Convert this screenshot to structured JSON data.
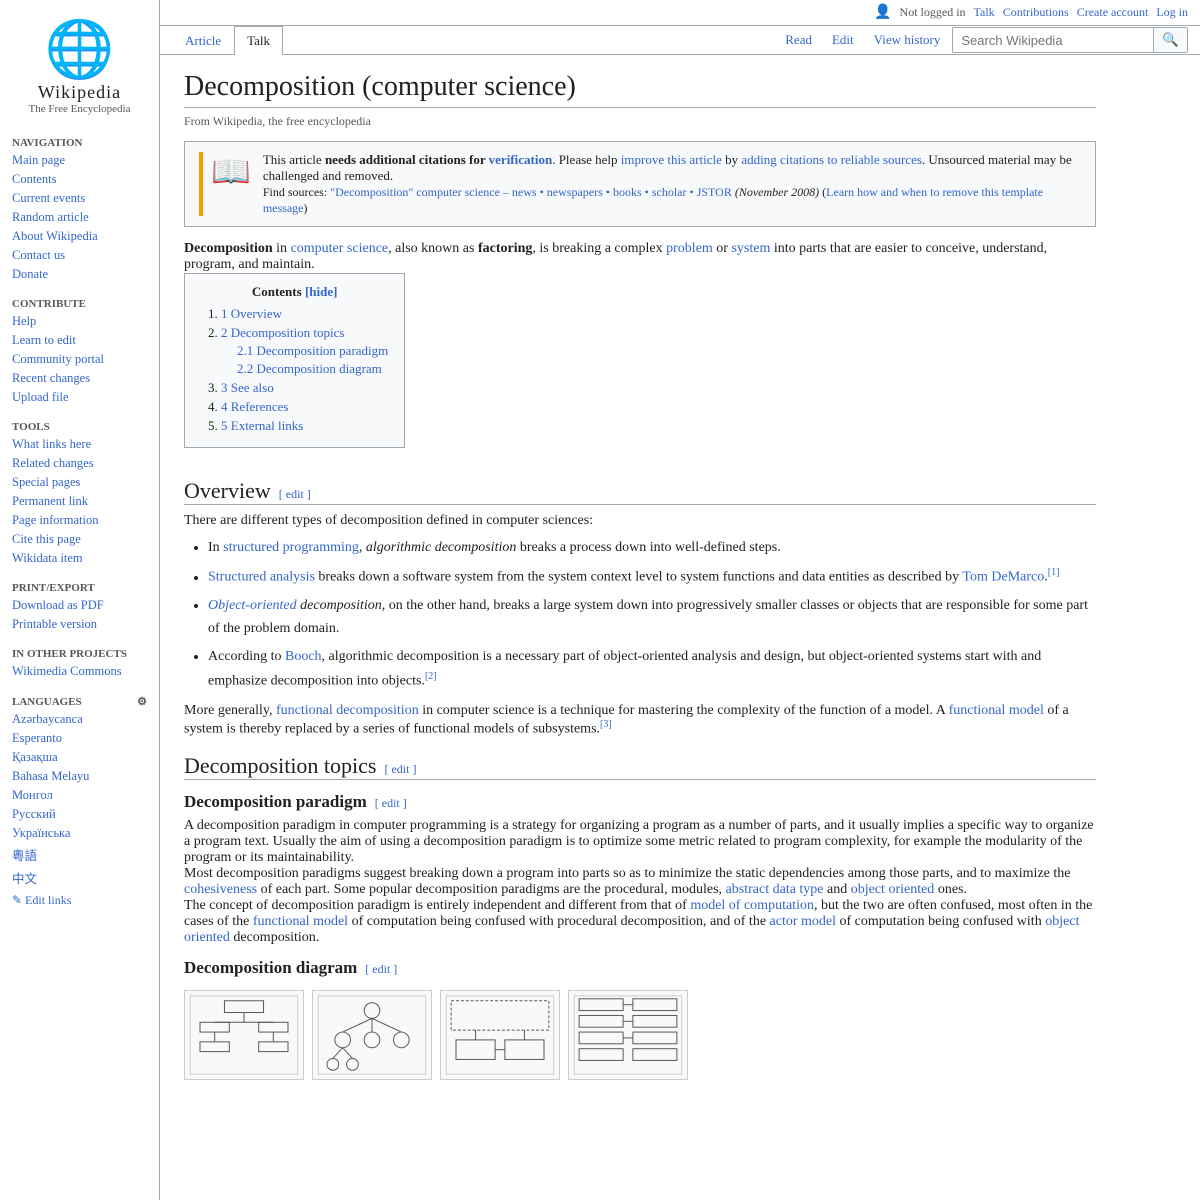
{
  "topbar": {
    "not_logged_in": "Not logged in",
    "talk": "Talk",
    "contributions": "Contributions",
    "create_account": "Create account",
    "log_in": "Log in"
  },
  "tabs": {
    "article": "Article",
    "talk": "Talk",
    "read": "Read",
    "edit": "Edit",
    "view_history": "View history"
  },
  "search": {
    "placeholder": "Search Wikipedia"
  },
  "logo": {
    "site_name": "Wikipedia",
    "tagline": "The Free Encyclopedia"
  },
  "sidebar": {
    "navigation_title": "Navigation",
    "nav_items": [
      {
        "label": "Main page",
        "href": "#"
      },
      {
        "label": "Contents",
        "href": "#"
      },
      {
        "label": "Current events",
        "href": "#"
      },
      {
        "label": "Random article",
        "href": "#"
      },
      {
        "label": "About Wikipedia",
        "href": "#"
      },
      {
        "label": "Contact us",
        "href": "#"
      },
      {
        "label": "Donate",
        "href": "#"
      }
    ],
    "contribute_title": "Contribute",
    "contribute_items": [
      {
        "label": "Help",
        "href": "#"
      },
      {
        "label": "Learn to edit",
        "href": "#"
      },
      {
        "label": "Community portal",
        "href": "#"
      },
      {
        "label": "Recent changes",
        "href": "#"
      },
      {
        "label": "Upload file",
        "href": "#"
      }
    ],
    "tools_title": "Tools",
    "tools_items": [
      {
        "label": "What links here",
        "href": "#"
      },
      {
        "label": "Related changes",
        "href": "#"
      },
      {
        "label": "Special pages",
        "href": "#"
      },
      {
        "label": "Permanent link",
        "href": "#"
      },
      {
        "label": "Page information",
        "href": "#"
      },
      {
        "label": "Cite this page",
        "href": "#"
      },
      {
        "label": "Wikidata item",
        "href": "#"
      }
    ],
    "printexport_title": "Print/export",
    "printexport_items": [
      {
        "label": "Download as PDF",
        "href": "#"
      },
      {
        "label": "Printable version",
        "href": "#"
      }
    ],
    "otherprojects_title": "In other projects",
    "otherprojects_items": [
      {
        "label": "Wikimedia Commons",
        "href": "#"
      }
    ],
    "languages_title": "Languages",
    "language_items": [
      {
        "label": "Azərbaycanca",
        "href": "#"
      },
      {
        "label": "Esperanto",
        "href": "#"
      },
      {
        "label": "Қазақша",
        "href": "#"
      },
      {
        "label": "Bahasa Melayu",
        "href": "#"
      },
      {
        "label": "Монгол",
        "href": "#"
      },
      {
        "label": "Русский",
        "href": "#"
      },
      {
        "label": "Українська",
        "href": "#"
      },
      {
        "label": "粵語",
        "href": "#"
      },
      {
        "label": "中文",
        "href": "#"
      }
    ],
    "edit_links": "✎ Edit links"
  },
  "article": {
    "title": "Decomposition (computer science)",
    "from_wiki": "From Wikipedia, the free encyclopedia",
    "citation_box": {
      "text1": "This article ",
      "bold1": "needs additional citations for ",
      "link1": "verification",
      "text2": ". Please help ",
      "link2": "improve this article",
      "text3": " by ",
      "link3": "adding citations to reliable sources",
      "text4": ". Unsourced material may be challenged and removed.",
      "find": "Find sources: ",
      "find_links": "\"Decomposition\" computer science – news • newspapers • books • scholar • JSTOR",
      "date": "(November 2008)",
      "learn": "(Learn how and when to remove this template message)"
    },
    "intro": "Decomposition in computer science, also known as factoring, is breaking a complex problem or system into parts that are easier to conceive, understand, program, and maintain.",
    "toc": {
      "title": "Contents",
      "hide": "[hide]",
      "items": [
        {
          "num": "1",
          "label": "Overview"
        },
        {
          "num": "2",
          "label": "Decomposition topics"
        },
        {
          "num": "2.1",
          "label": "Decomposition paradigm",
          "sub": true
        },
        {
          "num": "2.2",
          "label": "Decomposition diagram",
          "sub": true
        },
        {
          "num": "3",
          "label": "See also"
        },
        {
          "num": "4",
          "label": "References"
        },
        {
          "num": "5",
          "label": "External links"
        }
      ]
    },
    "overview": {
      "heading": "Overview",
      "edit": "[ edit ]",
      "intro": "There are different types of decomposition defined in computer sciences:",
      "items": [
        {
          "text": "In structured programming, algorithmic decomposition breaks a process down into well-defined steps."
        },
        {
          "text": "Structured analysis breaks down a software system from the system context level to system functions and data entities as described by Tom DeMarco.[1]"
        },
        {
          "text": "Object-oriented decomposition, on the other hand, breaks a large system down into progressively smaller classes or objects that are responsible for some part of the problem domain."
        },
        {
          "text": "According to Booch, algorithmic decomposition is a necessary part of object-oriented analysis and design, but object-oriented systems start with and emphasize decomposition into objects.[2]"
        }
      ],
      "para2": "More generally, functional decomposition in computer science is a technique for mastering the complexity of the function of a model. A functional model of a system is thereby replaced by a series of functional models of subsystems.[3]"
    },
    "decomposition_topics": {
      "heading": "Decomposition topics",
      "edit": "[ edit ]",
      "paradigm": {
        "heading": "Decomposition paradigm",
        "edit": "[ edit ]",
        "para1": "A decomposition paradigm in computer programming is a strategy for organizing a program as a number of parts, and it usually implies a specific way to organize a program text. Usually the aim of using a decomposition paradigm is to optimize some metric related to program complexity, for example the modularity of the program or its maintainability.",
        "para2": "Most decomposition paradigms suggest breaking down a program into parts so as to minimize the static dependencies among those parts, and to maximize the cohesiveness of each part. Some popular decomposition paradigms are the procedural, modules, abstract data type and object oriented ones.",
        "para3": "The concept of decomposition paradigm is entirely independent and different from that of model of computation, but the two are often confused, most often in the cases of the functional model of computation being confused with procedural decomposition, and of the actor model of computation being confused with object oriented decomposition."
      },
      "diagram": {
        "heading": "Decomposition diagram",
        "edit": "[ edit ]"
      }
    }
  }
}
